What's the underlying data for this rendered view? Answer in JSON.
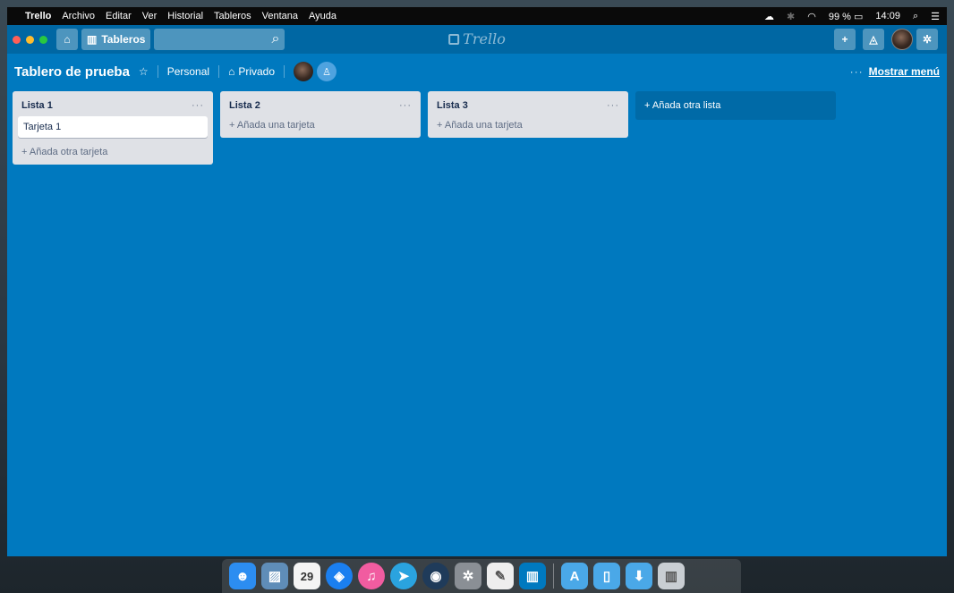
{
  "menubar": {
    "app": "Trello",
    "menus": [
      "Archivo",
      "Editar",
      "Ver",
      "Historial",
      "Tableros",
      "Ventana",
      "Ayuda"
    ],
    "battery": "99 %",
    "time": "14:09"
  },
  "header": {
    "boards_label": "Tableros",
    "logo": "Trello",
    "search_placeholder": ""
  },
  "board": {
    "title": "Tablero de prueba",
    "team": "Personal",
    "visibility": "Privado",
    "show_menu": "Mostrar menú"
  },
  "lists": [
    {
      "title": "Lista 1",
      "cards": [
        "Tarjeta 1"
      ],
      "add_card": "+ Añada otra tarjeta"
    },
    {
      "title": "Lista 2",
      "cards": [],
      "add_card": "+ Añada una tarjeta"
    },
    {
      "title": "Lista 3",
      "cards": [],
      "add_card": "+ Añada una tarjeta"
    }
  ],
  "add_list": "+ Añada otra lista",
  "dock": {
    "calendar_day": "29",
    "apps": [
      "finder-icon",
      "preview-icon",
      "calendar-icon",
      "safari-icon",
      "itunes-icon",
      "telegram-icon",
      "steam-icon",
      "system-preferences-icon",
      "textedit-icon",
      "trello-icon",
      "applications-folder-icon",
      "documents-folder-icon",
      "downloads-folder-icon",
      "trash-icon"
    ]
  },
  "colors": {
    "board_bg": "#0079bf",
    "header_bg": "#0067a3",
    "list_bg": "#dfe1e6"
  }
}
